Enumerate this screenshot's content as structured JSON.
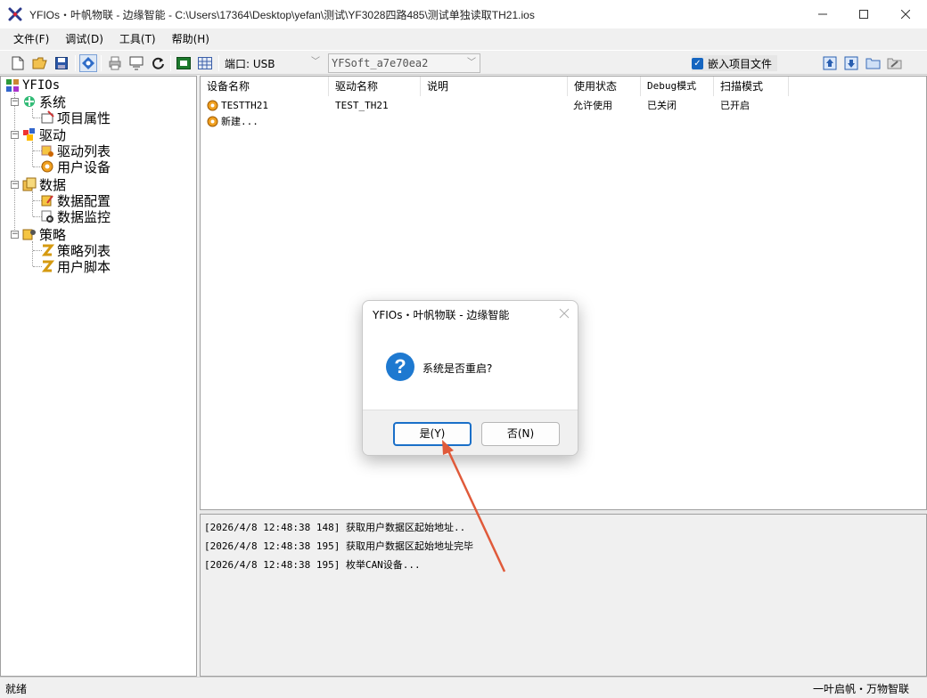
{
  "window": {
    "title": "YFIOs・叶帆物联 - 边缘智能 - C:\\Users\\17364\\Desktop\\yefan\\测试\\YF3028四路485\\测试单独读取TH21.ios",
    "icon": "yfios-logo-icon",
    "controls": [
      "minimize-icon",
      "maximize-icon",
      "close-icon"
    ]
  },
  "menu": [
    "文件(F)",
    "调试(D)",
    "工具(T)",
    "帮助(H)"
  ],
  "toolbar": {
    "buttons": [
      "new-file-icon",
      "open-folder-icon",
      "save-icon",
      "debug-mode-icon",
      "print-icon",
      "download-icon",
      "refresh-icon",
      "screen-icon",
      "grid-icon"
    ],
    "port_label": "端口: USB",
    "device_value": "YFSoft_a7e70ea2",
    "embed_checked": true,
    "embed_label": "嵌入项目文件",
    "right_buttons": [
      "upload-icon",
      "download-file-icon",
      "folder-icon",
      "folder-edit-icon"
    ]
  },
  "tree": {
    "root": "YFIOs",
    "groups": [
      {
        "label": "系统",
        "icon": "system-icon",
        "children": [
          {
            "label": "项目属性",
            "icon": "project-properties-icon"
          }
        ]
      },
      {
        "label": "驱动",
        "icon": "driver-icon",
        "children": [
          {
            "label": "驱动列表",
            "icon": "driver-list-icon"
          },
          {
            "label": "用户设备",
            "icon": "user-device-icon"
          }
        ]
      },
      {
        "label": "数据",
        "icon": "data-icon",
        "children": [
          {
            "label": "数据配置",
            "icon": "data-config-icon"
          },
          {
            "label": "数据监控",
            "icon": "data-monitor-icon"
          }
        ]
      },
      {
        "label": "策略",
        "icon": "strategy-icon",
        "children": [
          {
            "label": "策略列表",
            "icon": "strategy-list-icon"
          },
          {
            "label": "用户脚本",
            "icon": "user-script-icon"
          }
        ]
      }
    ]
  },
  "device_list": {
    "columns": [
      "设备名称",
      "驱动名称",
      "说明",
      "使用状态",
      "Debug模式",
      "扫描模式"
    ],
    "rows": [
      {
        "name": "TESTTH21",
        "driver": "TEST_TH21",
        "desc": "",
        "status": "允许使用",
        "debug": "已关闭",
        "scan": "已开启"
      },
      {
        "name": "新建...",
        "driver": "",
        "desc": "",
        "status": "",
        "debug": "",
        "scan": ""
      }
    ]
  },
  "log": [
    "[2026/4/8 12:48:38 148] 获取用户数据区起始地址..",
    "[2026/4/8 12:48:38 195] 获取用户数据区起始地址完毕",
    "[2026/4/8 12:48:38 195] 枚举CAN设备..."
  ],
  "status": {
    "left": "就绪",
    "right": "一叶启帆・万物智联"
  },
  "dialog": {
    "title": "YFIOs・叶帆物联 - 边缘智能",
    "message": "系统是否重启?",
    "icon": "question-icon",
    "yes_label": "是(Y)",
    "no_label": "否(N)"
  },
  "colors": {
    "accent": "#1a6fc8",
    "annotation_arrow": "#e05a3a"
  }
}
